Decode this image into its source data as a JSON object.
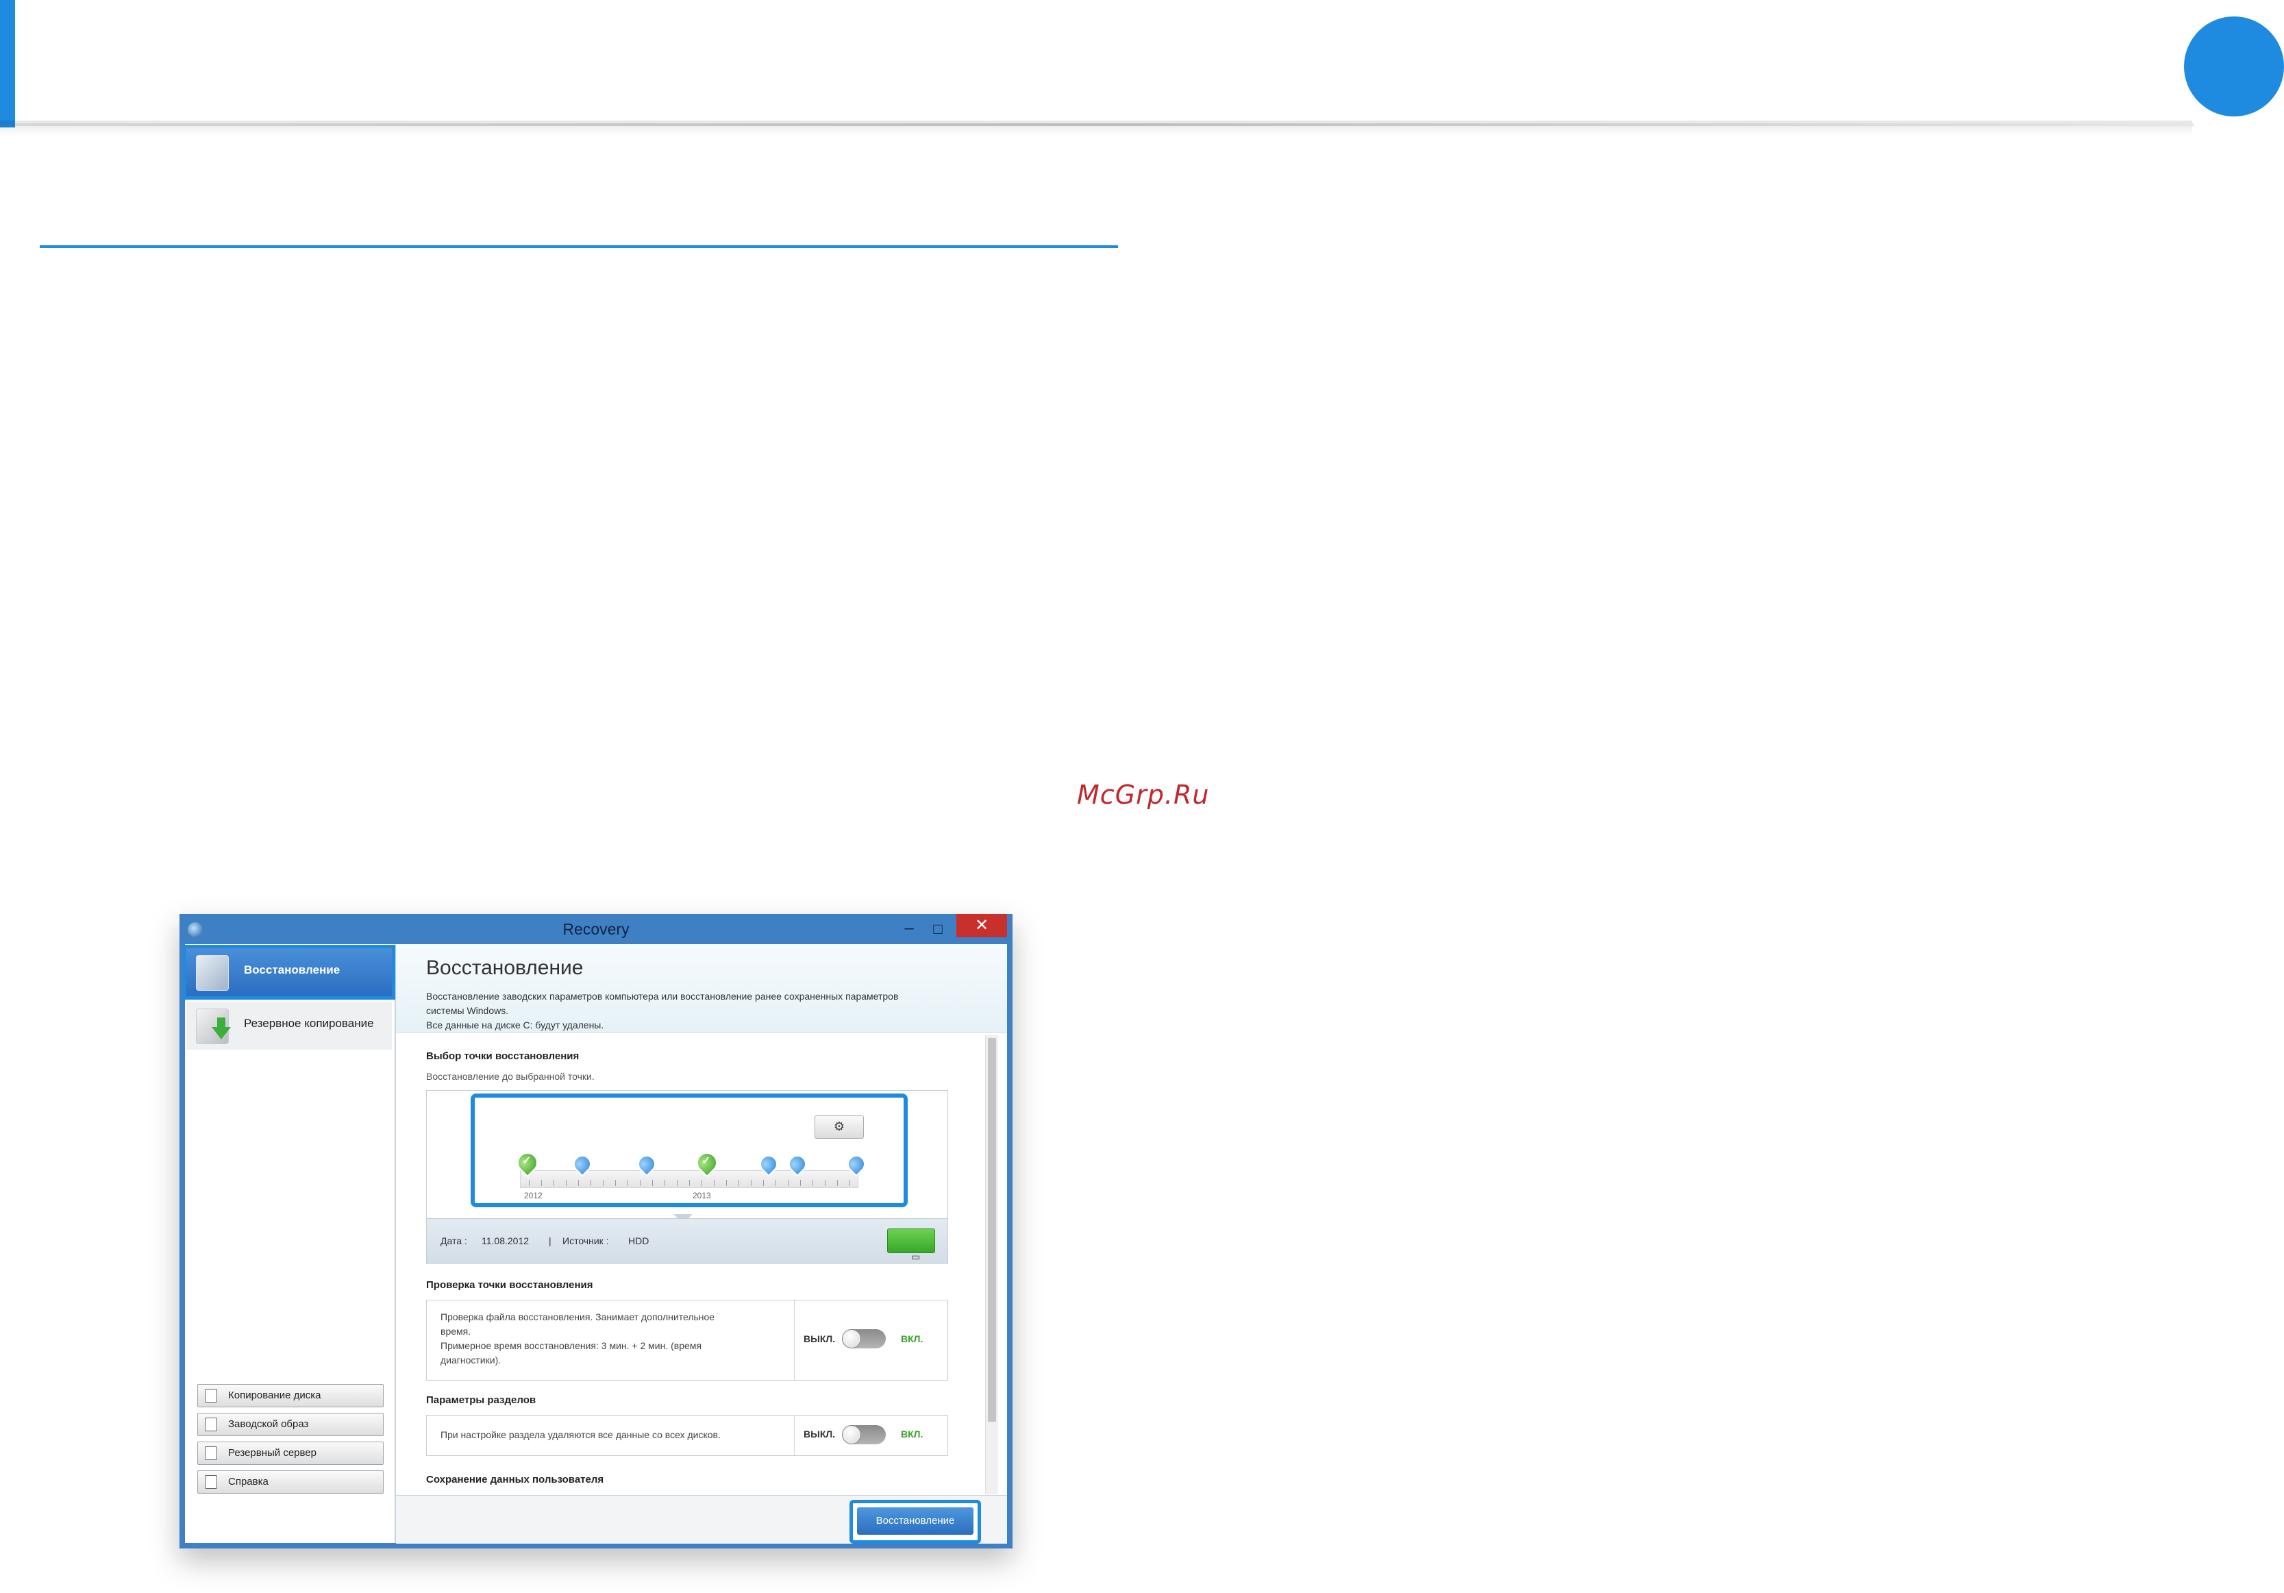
{
  "watermark": "McGrp.Ru",
  "window": {
    "title": "Recovery",
    "minimize": "–",
    "maximize": "□",
    "close": "✕"
  },
  "sidebar": {
    "nav": [
      {
        "label": "Восстановление",
        "icon": "disk-restore-icon",
        "active": true
      },
      {
        "label": "Резервное копирование",
        "icon": "disk-backup-icon",
        "active": false
      }
    ],
    "buttons": [
      {
        "label": "Копирование диска",
        "icon": "disk-copy-icon"
      },
      {
        "label": "Заводской образ",
        "icon": "factory-image-icon"
      },
      {
        "label": "Резервный сервер",
        "icon": "backup-server-icon"
      },
      {
        "label": "Справка",
        "icon": "help-icon"
      }
    ]
  },
  "main": {
    "title": "Восстановление",
    "description": [
      "Восстановление заводских параметров компьютера или восстановление ранее сохраненных параметров",
      "системы Windows.",
      "Все данные на диске C: будут удалены."
    ],
    "restore_point": {
      "title": "Выбор точки восстановления",
      "subtitle": "Восстановление до выбранной точки.",
      "years": [
        "2012",
        "2013"
      ],
      "date_label": "Дата :",
      "date_value": "11.08.2012",
      "separator": "|",
      "source_label": "Источник :",
      "source_value": "HDD"
    },
    "check": {
      "title": "Проверка точки восстановления",
      "text_lines": [
        "Проверка файла восстановления. Занимает дополнительное",
        "время.",
        "Примерное время восстановления: 3 мин. + 2 мин. (время",
        "диагностики)."
      ],
      "off": "ВЫКЛ.",
      "on": "ВКЛ."
    },
    "partitions": {
      "title": "Параметры разделов",
      "text": "При настройке раздела удаляются все данные со всех дисков.",
      "off": "ВЫКЛ.",
      "on": "ВКЛ."
    },
    "user_data": {
      "title": "Сохранение данных пользователя"
    },
    "restore_button": "Восстановление"
  },
  "colors": {
    "accent": "#1e8ae0",
    "titlebar": "#3f7fc4",
    "close": "#c9302c",
    "on_green": "#3aa02a"
  }
}
